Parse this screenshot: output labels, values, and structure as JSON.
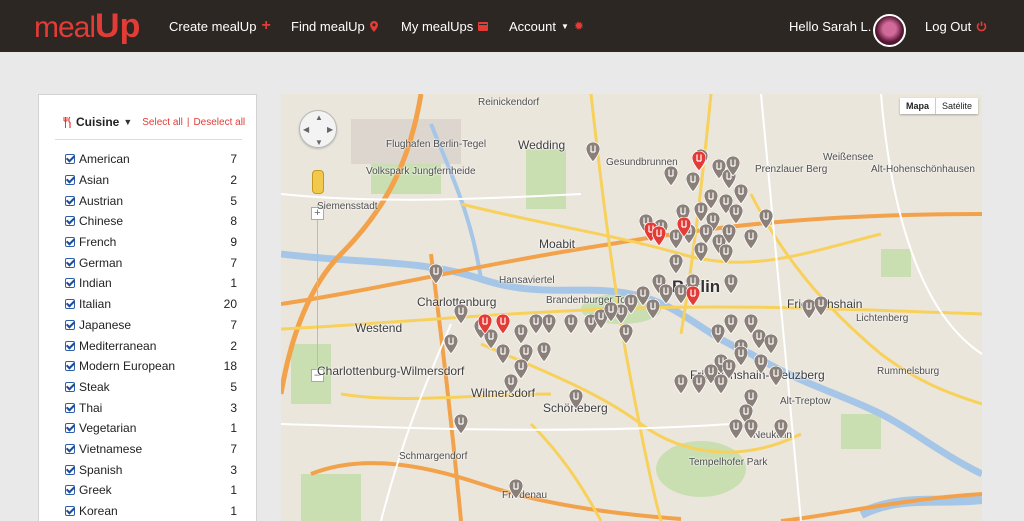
{
  "brand": {
    "meal": "meal",
    "up": "Up"
  },
  "nav": {
    "create": "Create mealUp",
    "find": "Find mealUp",
    "my": "My mealUps",
    "account": "Account",
    "greeting": "Hello Sarah L.",
    "logout": "Log Out"
  },
  "filter": {
    "title": "Cuisine",
    "select_all": "Select all",
    "deselect_all": "Deselect all",
    "separator": "|",
    "items": [
      {
        "label": "American",
        "count": "7"
      },
      {
        "label": "Asian",
        "count": "2"
      },
      {
        "label": "Austrian",
        "count": "5"
      },
      {
        "label": "Chinese",
        "count": "8"
      },
      {
        "label": "French",
        "count": "9"
      },
      {
        "label": "German",
        "count": "7"
      },
      {
        "label": "Indian",
        "count": "1"
      },
      {
        "label": "Italian",
        "count": "20"
      },
      {
        "label": "Japanese",
        "count": "7"
      },
      {
        "label": "Mediterranean",
        "count": "2"
      },
      {
        "label": "Modern European",
        "count": "18"
      },
      {
        "label": "Steak",
        "count": "5"
      },
      {
        "label": "Thai",
        "count": "3"
      },
      {
        "label": "Vegetarian",
        "count": "1"
      },
      {
        "label": "Vietnamese",
        "count": "7"
      },
      {
        "label": "Spanish",
        "count": "3"
      },
      {
        "label": "Greek",
        "count": "1"
      },
      {
        "label": "Korean",
        "count": "1"
      }
    ]
  },
  "map": {
    "type_map": "Mapa",
    "type_satellite": "Satélite",
    "zoom_in": "+",
    "zoom_out": "–",
    "labels": {
      "berlin": "Berlin",
      "charlottenburg": "Charlottenburg",
      "charlottenburg_wilmersdorf": "Charlottenburg-Wilmersdorf",
      "wilmersdorf": "Wilmersdorf",
      "schoneberg": "Schöneberg",
      "friedenau": "Friedenau",
      "schmargendorf": "Schmargendorf",
      "westend": "Westend",
      "moabit": "Moabit",
      "wedding": "Wedding",
      "gesundbrunnen": "Gesundbrunnen",
      "reinickendorf": "Reinickendorf",
      "prenzlauer": "Prenzlauer Berg",
      "friedrichshain": "Friedrichshain",
      "lichtenberg": "Lichtenberg",
      "kreuzberg": "Friedrichshain-Kreuzberg",
      "neukolln": "Neukölln",
      "treptow": "Alt-Treptow",
      "tempelhof": "Tempelhofer Park",
      "weissensee": "Weißensee",
      "hohenschonhausen": "Alt-Hohenschönhausen",
      "rummelsburg": "Rummelsburg",
      "flughafen": "Flughafen Berlin-Tegel",
      "jungfernheide": "Volkspark Jungfernheide",
      "siemensstadt": "Siemensstadt",
      "hansaviertel": "Hansaviertel",
      "brandenburger": "Brandenburger Tor"
    }
  },
  "colors": {
    "accent": "#e33b36",
    "header": "#2d2723",
    "pin_gray": "#8a7f79"
  }
}
